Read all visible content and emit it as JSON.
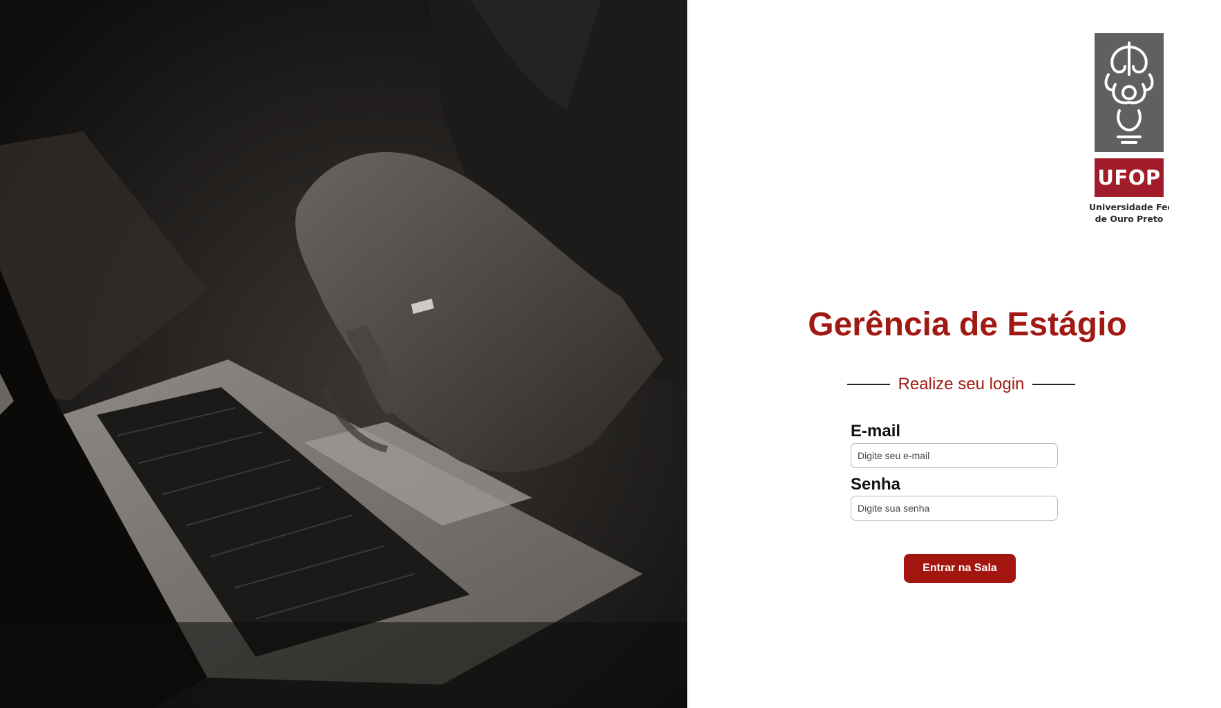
{
  "hero_image": {
    "description_icon": "laptop-typing-photo"
  },
  "logo": {
    "acronym": "UFOP",
    "name_line1": "Universidade Federal",
    "name_line2": "de Ouro Preto",
    "emblem_icon": "ufop-emblem-icon",
    "brand_color": "#a01c2a",
    "emblem_bg": "#5f6062"
  },
  "login": {
    "title": "Gerência de Estágio",
    "subtitle": "Realize seu login",
    "email_label": "E-mail",
    "email_placeholder": "Digite seu e-mail",
    "password_label": "Senha",
    "password_placeholder": "Digite sua senha",
    "submit_label": "Entrar na Sala",
    "accent_color": "#a01a13"
  }
}
